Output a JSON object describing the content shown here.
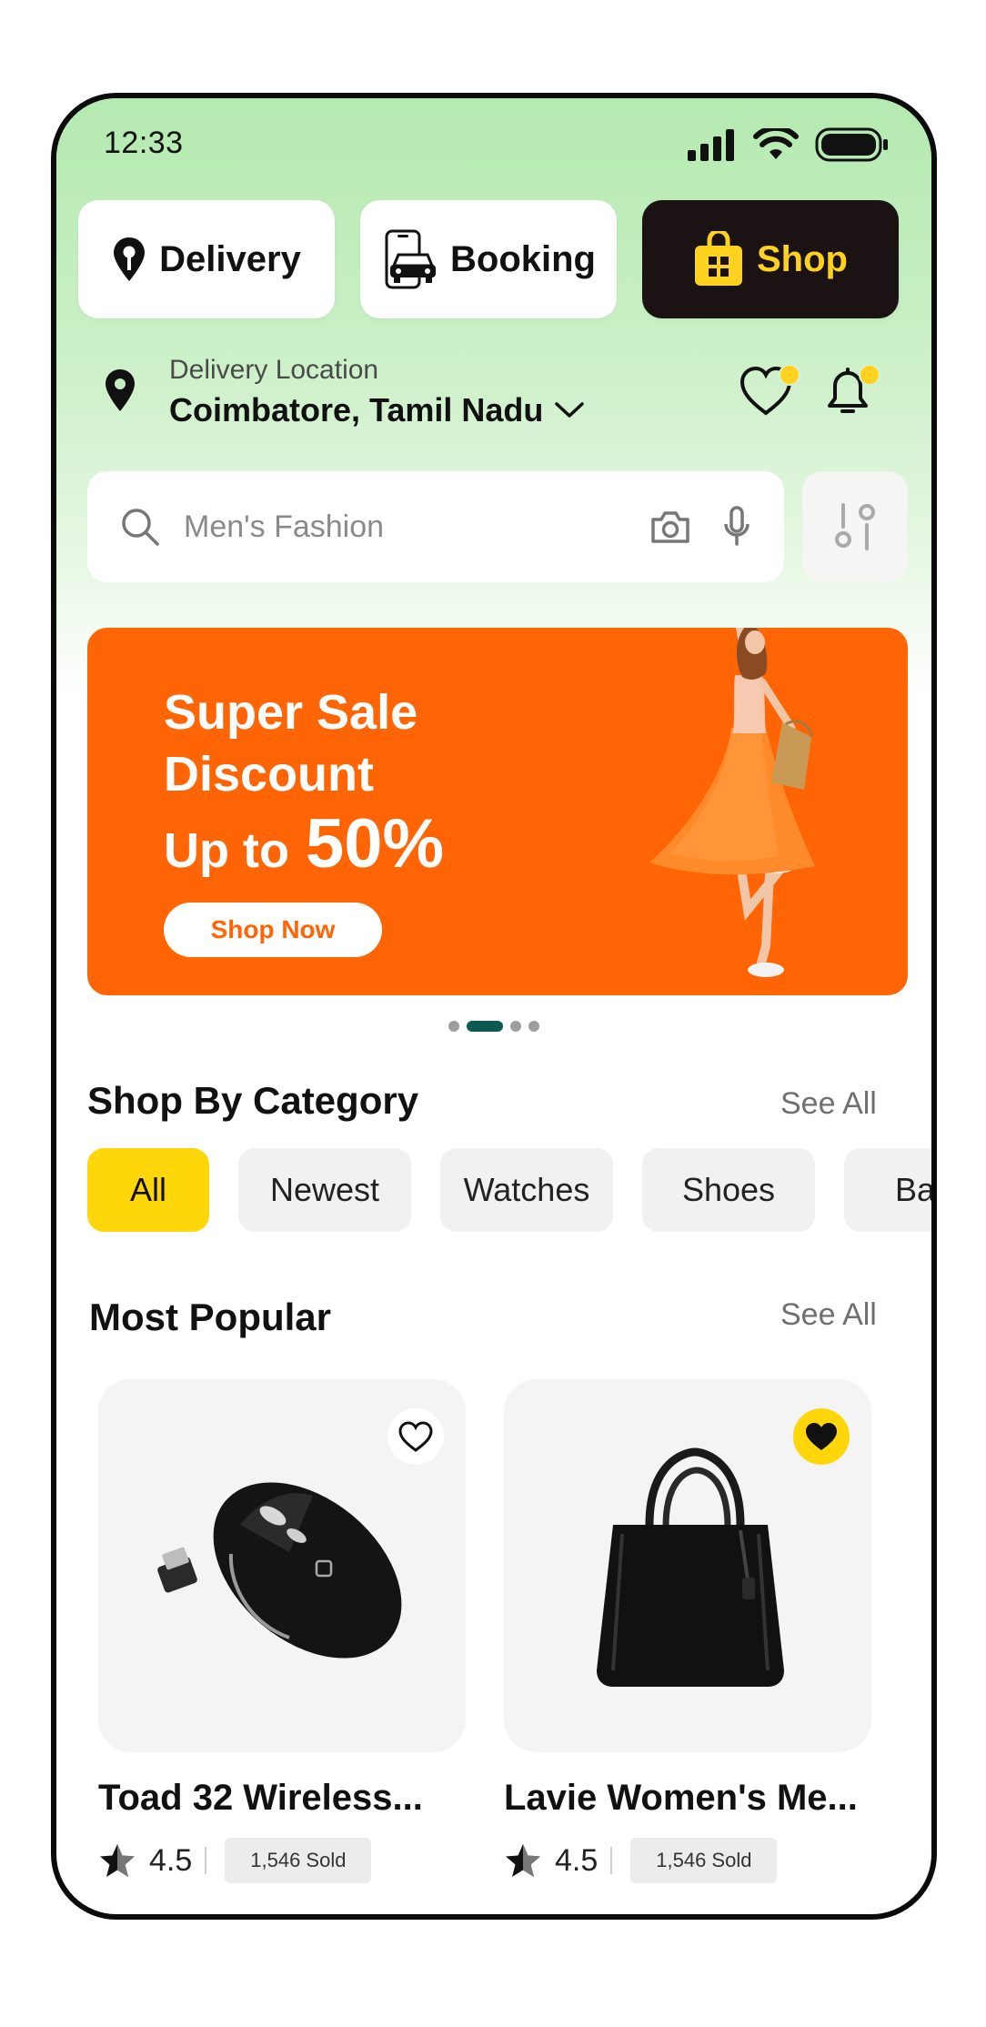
{
  "status_bar": {
    "time": "12:33"
  },
  "modes": [
    {
      "label": "Delivery",
      "icon": "location-pin-icon",
      "active": false
    },
    {
      "label": "Booking",
      "icon": "car-phone-icon",
      "active": false
    },
    {
      "label": "Shop",
      "icon": "shopping-bag-icon",
      "active": true
    }
  ],
  "location": {
    "label": "Delivery Location",
    "value": "Coimbatore, Tamil Nadu"
  },
  "search": {
    "placeholder": "Men's Fashion"
  },
  "banner": {
    "line1": "Super Sale",
    "line2": "Discount",
    "line3_prefix": "Up to",
    "line3_value": "50%",
    "cta": "Shop Now",
    "bg_color": "#ff6405"
  },
  "carousel": {
    "count": 4,
    "active_index": 1
  },
  "categories": {
    "title": "Shop By Category",
    "see_all": "See All",
    "chips": [
      "All",
      "Newest",
      "Watches",
      "Shoes",
      "Ba"
    ],
    "active": "All"
  },
  "popular": {
    "title": "Most Popular",
    "see_all": "See All",
    "products": [
      {
        "name": "Toad 32 Wireless...",
        "rating": "4.5",
        "sold": "1,546 Sold",
        "favorited": false
      },
      {
        "name": "Lavie Women's Me...",
        "rating": "4.5",
        "sold": "1,546 Sold",
        "favorited": true
      }
    ]
  },
  "colors": {
    "accent_yellow": "#ffd60a",
    "dark": "#1b1313",
    "banner_orange": "#ff6405",
    "dot_active": "#0d5a54"
  }
}
